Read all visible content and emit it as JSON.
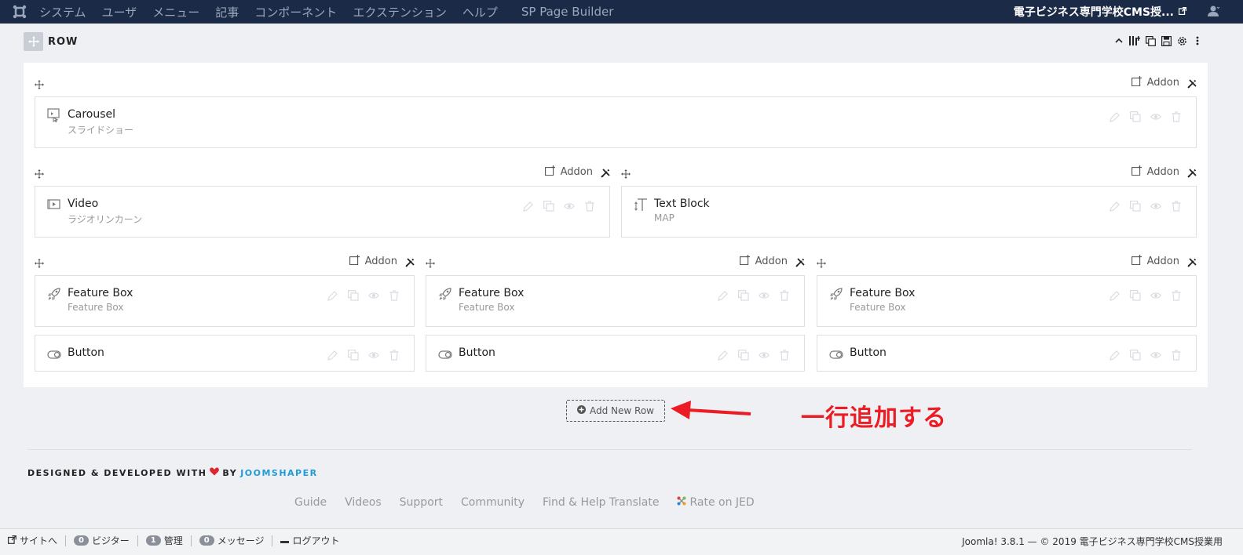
{
  "topbar": {
    "menu": [
      "システム",
      "ユーザ",
      "メニュー",
      "記事",
      "コンポーネント",
      "エクステンション",
      "ヘルプ"
    ],
    "page_builder": "SP Page Builder",
    "site_name": "電子ビジネス専門学校CMS授..."
  },
  "row_header": {
    "title": "ROW"
  },
  "addon_label": "Addon",
  "columns": {
    "c1": {
      "card1": {
        "name": "Carousel",
        "sub": "スライドショー"
      }
    },
    "c2a": {
      "card1": {
        "name": "Video",
        "sub": "ラジオリンカーン"
      }
    },
    "c2b": {
      "card1": {
        "name": "Text Block",
        "sub": "MAP"
      }
    },
    "c3a": {
      "card1": {
        "name": "Feature Box",
        "sub": "Feature Box"
      },
      "card2": {
        "name": "Button"
      }
    },
    "c3b": {
      "card1": {
        "name": "Feature Box",
        "sub": "Feature Box"
      },
      "card2": {
        "name": "Button"
      }
    },
    "c3c": {
      "card1": {
        "name": "Feature Box",
        "sub": "Feature Box"
      },
      "card2": {
        "name": "Button"
      }
    }
  },
  "add_row_label": "Add New Row",
  "annotation": "一行追加する",
  "credit": {
    "text": "DESIGNED & DEVELOPED WITH",
    "by": "BY",
    "brand": "JOOMSHAPER"
  },
  "footer_links": [
    "Guide",
    "Videos",
    "Support",
    "Community",
    "Find & Help Translate",
    "Rate on JED"
  ],
  "status": {
    "site": "サイトへ",
    "visitors_count": "0",
    "visitors": "ビジター",
    "admins_count": "1",
    "admins": "管理",
    "messages_count": "0",
    "messages": "メッセージ",
    "logout": "ログアウト",
    "right": "Joomla! 3.8.1 — © 2019 電子ビジネス専門学校CMS授業用"
  },
  "colors": {
    "topbar": "#1b2a47",
    "accent_red": "#ec1c24",
    "brand_blue": "#1f9bd8"
  }
}
